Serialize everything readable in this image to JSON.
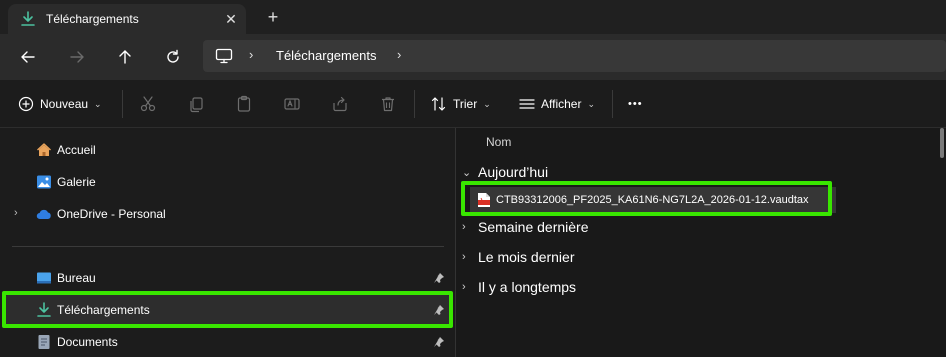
{
  "tab": {
    "title": "Téléchargements",
    "close_glyph": "✕",
    "new_glyph": "+"
  },
  "nav": {
    "back_icon": "arrow-left-icon",
    "forward_icon": "arrow-right-icon",
    "up_icon": "arrow-up-icon",
    "refresh_icon": "refresh-icon",
    "breadcrumb": [
      "Téléchargements"
    ],
    "separator": "›"
  },
  "toolbar": {
    "new_label": "Nouveau",
    "sort_label": "Trier",
    "view_label": "Afficher",
    "more_glyph": "•••"
  },
  "sidebar": {
    "items": [
      {
        "label": "Accueil",
        "icon": "home-icon"
      },
      {
        "label": "Galerie",
        "icon": "gallery-icon"
      },
      {
        "label": "OneDrive - Personal",
        "icon": "cloud-icon",
        "expandable": true
      },
      {
        "label": "Bureau",
        "icon": "desktop-icon",
        "pinned": true
      },
      {
        "label": "Téléchargements",
        "icon": "download-icon",
        "pinned": true,
        "selected": true
      },
      {
        "label": "Documents",
        "icon": "documents-icon",
        "pinned": true
      }
    ]
  },
  "content": {
    "column_name": "Nom",
    "groups": [
      {
        "label": "Aujourd’hui",
        "expanded": true
      },
      {
        "label": "Semaine dernière",
        "expanded": false
      },
      {
        "label": "Le mois dernier",
        "expanded": false
      },
      {
        "label": "Il y a longtemps",
        "expanded": false
      }
    ],
    "file": {
      "name": "CTB93312006_PF2025_KA61N6-NG7L2A_2026-01-12.vaudtax",
      "icon": "pdf-icon"
    }
  },
  "colors": {
    "accent": "#39e600",
    "download_green": "#4cc2a0",
    "pdf_red": "#d93025",
    "folder_blue": "#3a8ee6"
  }
}
